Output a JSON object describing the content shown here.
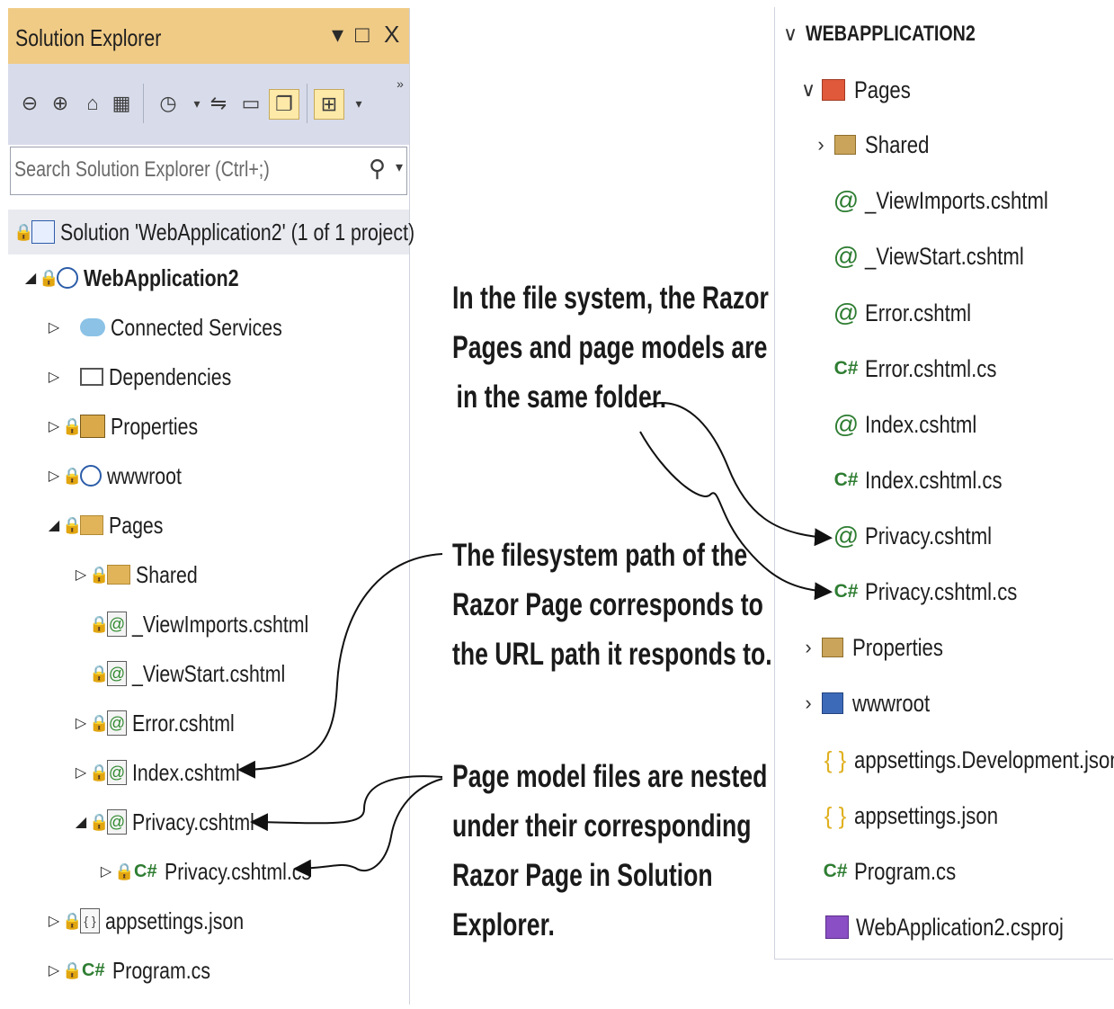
{
  "solution_explorer": {
    "title": "Solution Explorer",
    "window_buttons": [
      "▾",
      "□",
      "X"
    ],
    "search_placeholder": "Search Solution Explorer (Ctrl+;)",
    "solution_label": "Solution 'WebApplication2' (1 of 1 project)",
    "tree": [
      {
        "label": "WebApplication2",
        "icon": "web-project-icon"
      },
      {
        "label": "Connected Services",
        "icon": "connected-services-icon"
      },
      {
        "label": "Dependencies",
        "icon": "dependencies-icon"
      },
      {
        "label": "Properties",
        "icon": "properties-icon"
      },
      {
        "label": "wwwroot",
        "icon": "globe-icon"
      },
      {
        "label": "Pages",
        "icon": "folder-icon"
      },
      {
        "label": "Shared",
        "icon": "folder-icon"
      },
      {
        "label": "_ViewImports.cshtml",
        "icon": "razor-file-icon"
      },
      {
        "label": "_ViewStart.cshtml",
        "icon": "razor-file-icon"
      },
      {
        "label": "Error.cshtml",
        "icon": "razor-file-icon"
      },
      {
        "label": "Index.cshtml",
        "icon": "razor-file-icon"
      },
      {
        "label": "Privacy.cshtml",
        "icon": "razor-file-icon"
      },
      {
        "label": "Privacy.cshtml.cs",
        "icon": "csharp-file-icon"
      },
      {
        "label": "appsettings.json",
        "icon": "json-file-icon"
      },
      {
        "label": "Program.cs",
        "icon": "csharp-file-icon"
      }
    ]
  },
  "file_system": {
    "root": "WEBAPPLICATION2",
    "items": [
      {
        "label": "Pages"
      },
      {
        "label": "Shared"
      },
      {
        "label": "_ViewImports.cshtml"
      },
      {
        "label": "_ViewStart.cshtml"
      },
      {
        "label": "Error.cshtml"
      },
      {
        "label": "Error.cshtml.cs"
      },
      {
        "label": "Index.cshtml"
      },
      {
        "label": "Index.cshtml.cs"
      },
      {
        "label": "Privacy.cshtml"
      },
      {
        "label": "Privacy.cshtml.cs"
      },
      {
        "label": "Properties"
      },
      {
        "label": "wwwroot"
      },
      {
        "label": "appsettings.Development.json"
      },
      {
        "label": "appsettings.json"
      },
      {
        "label": "Program.cs"
      },
      {
        "label": "WebApplication2.csproj"
      }
    ]
  },
  "annotations": {
    "top": [
      "In the file system, the Razor",
      "Pages and page models are",
      "in the same folder."
    ],
    "middle": [
      "The filesystem path of the",
      "Razor Page corresponds to",
      "the URL path it responds to."
    ],
    "bottom": [
      "Page model files are nested",
      "under their corresponding",
      "Razor Page in Solution",
      "Explorer."
    ]
  },
  "glyphs": {
    "at": "@",
    "csharp": "C#",
    "json": "{ }",
    "lock": "🔒"
  }
}
